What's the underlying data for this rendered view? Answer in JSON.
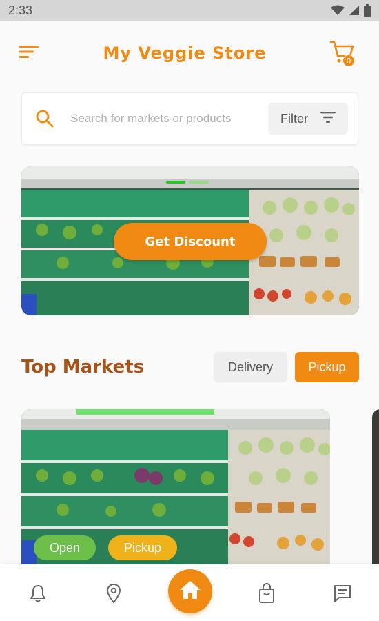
{
  "status_bar": {
    "time": "2:33",
    "icons": [
      "wifi-icon",
      "signal-icon",
      "battery-icon"
    ]
  },
  "header": {
    "title": "My Veggie Store",
    "menu_icon": "menu-icon",
    "cart_icon": "cart-icon",
    "cart_count": "0"
  },
  "search": {
    "placeholder": "Search for markets or products",
    "value": "",
    "filter_label": "Filter"
  },
  "banner": {
    "button_label": "Get Discount",
    "slide_count": 2,
    "active_slide": 1
  },
  "top_markets": {
    "title": "Top Markets",
    "toggles": [
      {
        "label": "Delivery",
        "selected": false
      },
      {
        "label": "Pickup",
        "selected": true
      }
    ],
    "cards": [
      {
        "tags": [
          {
            "label": "Open"
          },
          {
            "label": "Pickup"
          }
        ]
      }
    ]
  },
  "bottom_nav": {
    "items": [
      "bell-icon",
      "location-icon",
      "home-icon",
      "shopping-bag-icon",
      "chat-icon"
    ],
    "active": "home-icon"
  },
  "colors": {
    "accent": "#f08a12",
    "title_brown": "#a8521a",
    "open_green": "#6cc04a",
    "pickup_yellow": "#f0b21a"
  }
}
